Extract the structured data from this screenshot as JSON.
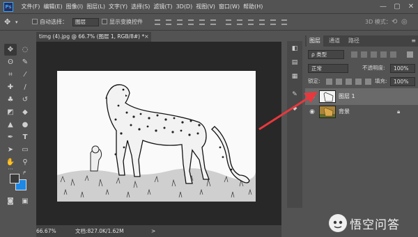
{
  "app": {
    "logo": "Ps"
  },
  "menubar": {
    "items": [
      "文件(F)",
      "编辑(E)",
      "图像(I)",
      "图层(L)",
      "文字(Y)",
      "选择(S)",
      "滤镜(T)",
      "3D(D)",
      "视图(V)",
      "窗口(W)",
      "帮助(H)"
    ],
    "window_controls": [
      "—",
      "▢",
      "✕"
    ]
  },
  "options_bar": {
    "auto_select_label": "自动选择：",
    "auto_select_value": "图层",
    "show_transform_label": "显示变换控件",
    "mode_3d_label": "3D 模式："
  },
  "document": {
    "tab_title": "timg (4).jpg @ 66.7% (图层 1, RGB/8#) *",
    "close": "×",
    "zoom": "66.67%",
    "doc_size": "文档:827.0K/1.62M",
    "nav_arrow": ">"
  },
  "colors": {
    "foreground": "#3a3a3a",
    "background": "#1e88e5",
    "accent": "#e8383d"
  },
  "layers_panel": {
    "tabs": [
      "图层",
      "通道",
      "路径"
    ],
    "menu_icon": "≡",
    "filter_label": "ρ 类型",
    "blend_mode": "正常",
    "opacity_label": "不透明度:",
    "opacity_value": "100%",
    "lock_label": "锁定:",
    "fill_label": "填充:",
    "fill_value": "100%",
    "layers": [
      {
        "name": "图层 1",
        "visible": true,
        "selected": true
      },
      {
        "name": "背景",
        "visible": true,
        "selected": false,
        "locked": true
      }
    ]
  },
  "watermark": {
    "text": "悟空问答"
  }
}
